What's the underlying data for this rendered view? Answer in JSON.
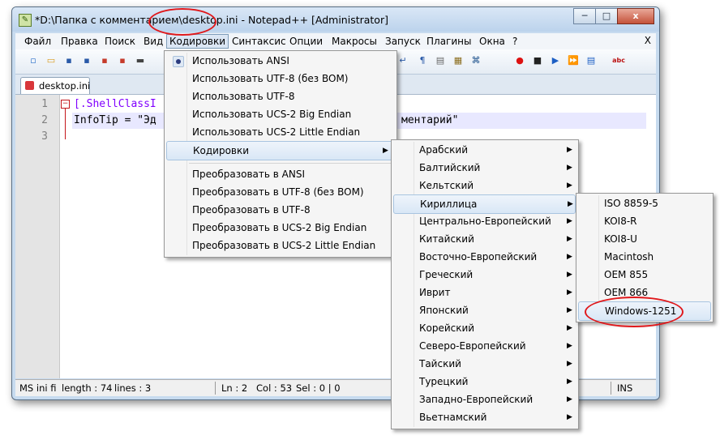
{
  "window": {
    "title": "*D:\\Папка с комментарием\\desktop.ini - Notepad++ [Administrator]",
    "minimize": "─",
    "maximize": "□",
    "close": "x"
  },
  "menubar": {
    "items": [
      "Файл",
      "Правка",
      "Поиск",
      "Вид",
      "Кодировки",
      "Синтаксис",
      "Опции",
      "Макросы",
      "Запуск",
      "Плагины",
      "Окна",
      "?"
    ],
    "close_label": "X"
  },
  "tab": {
    "label": "desktop.ini"
  },
  "editor": {
    "line_numbers": [
      "1",
      "2",
      "3"
    ],
    "fold_marker": "−",
    "lines": [
      "[.ShellClassI",
      "InfoTip = \"Эд",
      "",
      "ментарий\""
    ]
  },
  "status": {
    "type": "MS ini fi",
    "length": "length : 74",
    "lines": "lines : 3",
    "ln": "Ln : 2",
    "col": "Col : 53",
    "sel": "Sel : 0 | 0",
    "ins": "INS"
  },
  "encoding_menu": {
    "group1": [
      "Использовать ANSI",
      "Использовать UTF-8 (без BOM)",
      "Использовать UTF-8",
      "Использовать UCS-2 Big Endian",
      "Использовать UCS-2 Little Endian"
    ],
    "submenu": "Кодировки",
    "group2": [
      "Преобразовать в ANSI",
      "Преобразовать в UTF-8 (без BOM)",
      "Преобразовать в UTF-8",
      "Преобразовать в UCS-2 Big Endian",
      "Преобразовать в UCS-2 Little Endian"
    ]
  },
  "charset_menu": {
    "items": [
      "Арабский",
      "Балтийский",
      "Кельтский",
      "Кириллица",
      "Центрально-Европейский",
      "Китайский",
      "Восточно-Европейский",
      "Греческий",
      "Иврит",
      "Японский",
      "Корейский",
      "Северо-Европейский",
      "Тайский",
      "Турецкий",
      "Западно-Европейский",
      "Вьетнамский"
    ]
  },
  "cyrillic_menu": {
    "items": [
      "ISO 8859-5",
      "KOI8-R",
      "KOI8-U",
      "Macintosh",
      "OEM 855",
      "OEM 866",
      "Windows-1251"
    ]
  },
  "icons": {
    "toolbar": [
      "new-file-icon",
      "open-icon",
      "save-icon",
      "save-all-icon",
      "close-icon",
      "close-all-icon",
      "print-icon",
      "wrap-icon",
      "show-all-chars-icon",
      "indent-guide-icon",
      "user-lang-icon",
      "function-list-icon",
      "record-macro-icon",
      "stop-macro-icon",
      "play-macro-icon",
      "play-multiple-icon",
      "save-macro-icon",
      "spellcheck-icon"
    ],
    "toolbar_glyphs": [
      "▫",
      "▭",
      "▪",
      "▪",
      "▪",
      "▪",
      "▬",
      "↵",
      "¶",
      "▤",
      "▦",
      "⌘",
      "●",
      "■",
      "▶",
      "⏩",
      "▤",
      "abc"
    ]
  },
  "colors": {
    "accent": "#e0181b",
    "highlight": "#d9e7f6"
  }
}
